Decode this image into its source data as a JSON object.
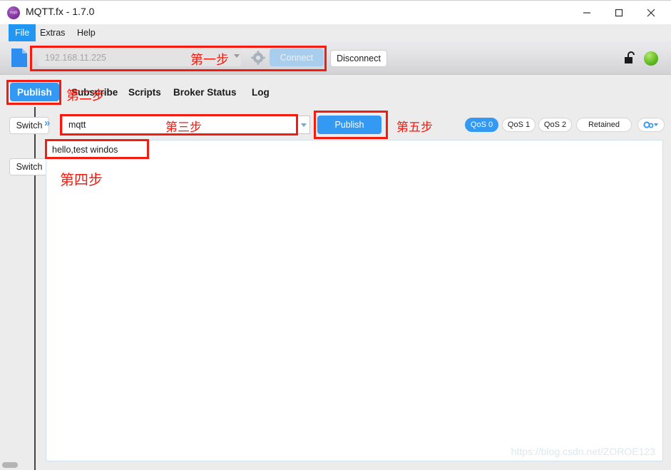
{
  "window": {
    "title": "MQTT.fx - 1.7.0",
    "app_icon_label": "mqtt",
    "minimize_label": "─",
    "maximize_label": "□",
    "close_label": "✕"
  },
  "menubar": {
    "items": [
      {
        "label": "File",
        "active": true
      },
      {
        "label": "Extras",
        "active": false
      },
      {
        "label": "Help",
        "active": false
      }
    ]
  },
  "connection_bar": {
    "document_icon": "document-icon",
    "broker_value": "192.168.11.225",
    "settings_icon": "gear-icon",
    "connect_label": "Connect",
    "disconnect_label": "Disconnect",
    "lock_icon": "unlocked-padlock-icon",
    "status_indicator": "green-status-dot"
  },
  "tabs": [
    {
      "label": "Publish",
      "active": true
    },
    {
      "label": "Subscribe",
      "active": false
    },
    {
      "label": "Scripts",
      "active": false
    },
    {
      "label": "Broker Status",
      "active": false
    },
    {
      "label": "Log",
      "active": false
    }
  ],
  "left_panel": {
    "switch_buttons": [
      {
        "label": "Switch"
      },
      {
        "label": "Switch"
      }
    ],
    "scrollbar": "horizontal-scrollbar"
  },
  "publish": {
    "expand_icon": "»",
    "topic_value": "mqtt",
    "topic_dropdown_icon": "chevron-down-icon",
    "publish_label": "Publish",
    "options": [
      {
        "label": "QoS 0",
        "selected": true
      },
      {
        "label": "QoS 1",
        "selected": false
      },
      {
        "label": "QoS 2",
        "selected": false
      },
      {
        "label": "Retained",
        "selected": false
      }
    ],
    "settings_pill_icon": "gear-dropdown-icon",
    "message_value": "hello,test windos"
  },
  "watermark": "https://blog.csdn.net/ZOROE123",
  "annotations": {
    "step1": "第一步",
    "step2": "第二步",
    "step3": "第三步",
    "step4": "第四步",
    "step5": "第五步",
    "color": "#f41b10"
  }
}
